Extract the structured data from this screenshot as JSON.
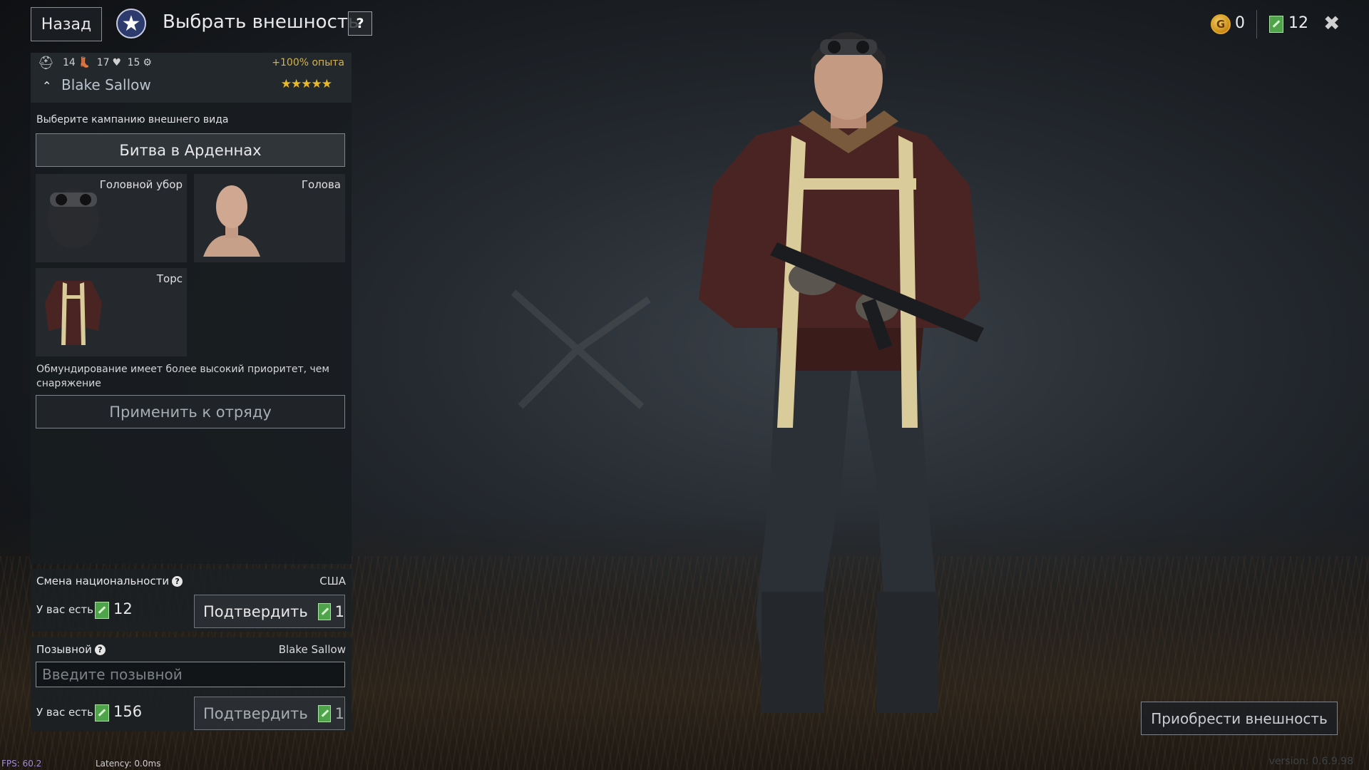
{
  "header": {
    "back_label": "Назад",
    "title": "Выбрать внешность",
    "help_label": "?",
    "gold_value": "0",
    "tickets_value": "12",
    "close_label": "✖"
  },
  "soldier": {
    "stat_1": "14",
    "stat_2": "17",
    "stat_3": "15",
    "xp_bonus": "+100% опыта",
    "name": "Blake Sallow",
    "stars": "★★★★★"
  },
  "appearance": {
    "campaign_label": "Выберите кампанию внешнего вида",
    "campaign_value": "Битва в Арденнах",
    "slots": [
      {
        "label": "Головной убор",
        "icon": "pilot-helmet-icon"
      },
      {
        "label": "Голова",
        "icon": "head-icon"
      },
      {
        "label": "Торс",
        "icon": "torso-jacket-icon"
      }
    ],
    "priority_note": "Обмундирование имеет более высокий приоритет, чем снаряжение",
    "apply_label": "Применить к отряду"
  },
  "nationality": {
    "title": "Смена национальности",
    "value": "США",
    "have_label": "У вас есть",
    "have_value": "12",
    "confirm_label": "Подтвердить",
    "confirm_cost": "1"
  },
  "callsign": {
    "title": "Позывной",
    "value": "Blake Sallow",
    "placeholder": "Введите позывной",
    "have_label": "У вас есть",
    "have_value": "156",
    "confirm_label": "Подтвердить",
    "confirm_cost": "1"
  },
  "footer": {
    "buy_label": "Приобрести внешность",
    "fps": "FPS: 60.2",
    "latency": "Latency:   0.0ms",
    "version": "version: 0.6.9.98"
  },
  "colors": {
    "ticket": "#4fa34a",
    "gold": "#e0a72a",
    "xp_bonus": "#d5b24b",
    "stars": "#e9b925"
  }
}
